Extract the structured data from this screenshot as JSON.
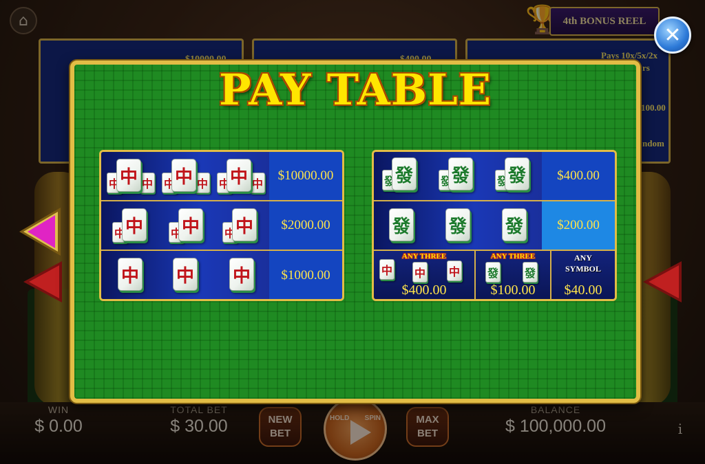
{
  "background": {
    "home_icon": "home-icon",
    "bonus_reel_label": "4th BONUS REEL",
    "panel_values": [
      "$10000.00",
      "$400.00",
      "Pays 10x/5x/2x"
    ],
    "panel_partial": [
      "rs",
      "100.00",
      "ndom"
    ]
  },
  "close_icon": "close-icon",
  "paytable": {
    "title": "PAY TABLE",
    "left_rows": [
      {
        "symbol": "red-dragon",
        "pay": "$10000.00"
      },
      {
        "symbol": "red-dragon",
        "pay": "$2000.00"
      },
      {
        "symbol": "red-dragon",
        "pay": "$1000.00"
      }
    ],
    "right_rows": [
      {
        "symbol": "green-dragon",
        "pay": "$400.00"
      },
      {
        "symbol": "green-dragon",
        "pay": "$200.00"
      }
    ],
    "right_sub": [
      {
        "label": "ANY THREE",
        "pay": "$400.00"
      },
      {
        "label": "ANY THREE",
        "pay": "$100.00"
      },
      {
        "label": "ANY SYMBOL",
        "pay": "$40.00"
      }
    ],
    "tile_glyphs": {
      "red": "中",
      "green": "發"
    },
    "colors": {
      "border": "#e2bd45",
      "felt": "#1f8a22",
      "pay_text": "#ffe44a",
      "title": "#ffe600"
    }
  },
  "footer": {
    "win_label": "WIN",
    "win_value": "$ 0.00",
    "total_bet_label": "TOTAL BET",
    "total_bet_value": "$ 30.00",
    "new_bet_label": "NEW BET",
    "max_bet_label": "MAX BET",
    "hold_label": "HOLD",
    "spin_label": "SPIN",
    "balance_label": "BALANCE",
    "balance_value": "$ 100,000.00",
    "info_label": "i"
  }
}
